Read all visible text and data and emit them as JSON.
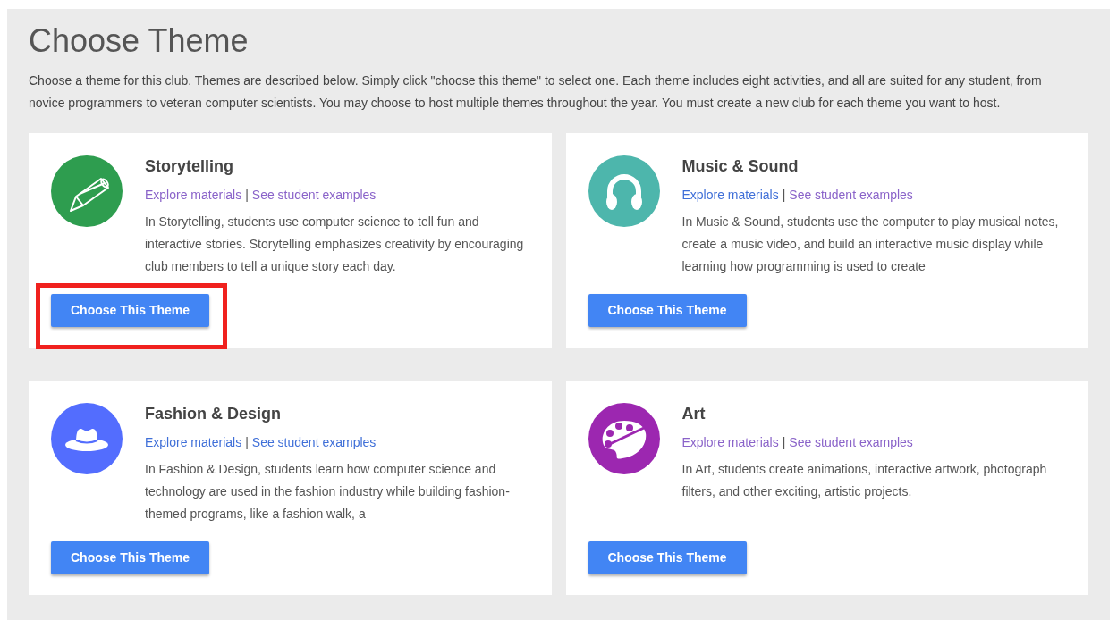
{
  "title": "Choose Theme",
  "intro": "Choose a theme for this club. Themes are described below. Simply click \"choose this theme\" to select one. Each theme includes eight activities, and all are suited for any student, from novice programmers to veteran computer scientists. You may choose to host multiple themes throughout the year. You must create a new club for each theme you want to host.",
  "themes": [
    {
      "name": "Storytelling",
      "color": "#2e9d4f",
      "links": [
        {
          "label": "Explore materials",
          "visited": true
        },
        {
          "label": "See student examples",
          "visited": true
        }
      ],
      "separator": "|",
      "description": "In Storytelling, students use computer science to tell fun and interactive stories. Storytelling emphasizes creativity by encouraging club members to tell a unique story each day.",
      "button": "Choose This Theme",
      "highlighted": true
    },
    {
      "name": "Music & Sound",
      "color": "#4db6ac",
      "links": [
        {
          "label": "Explore materials",
          "visited": false
        },
        {
          "label": "See student examples",
          "visited": true
        }
      ],
      "separator": "|",
      "description": "In Music & Sound, students use the computer to play musical notes, create a music video, and build an interactive music display while learning how programming is used to create",
      "button": "Choose This Theme",
      "highlighted": false
    },
    {
      "name": "Fashion & Design",
      "color": "#536dfe",
      "links": [
        {
          "label": "Explore materials",
          "visited": false
        },
        {
          "label": "See student examples",
          "visited": false
        }
      ],
      "separator": "|",
      "description": "In Fashion & Design, students learn how computer science and technology are used in the fashion industry while building fashion-themed programs, like a fashion walk, a",
      "button": "Choose This Theme",
      "highlighted": false
    },
    {
      "name": "Art",
      "color": "#9c27b0",
      "links": [
        {
          "label": "Explore materials",
          "visited": true
        },
        {
          "label": "See student examples",
          "visited": true
        }
      ],
      "separator": "|",
      "description": "In Art, students create animations, interactive artwork, photograph filters, and other exciting, artistic projects.",
      "button": "Choose This Theme",
      "highlighted": false
    }
  ]
}
